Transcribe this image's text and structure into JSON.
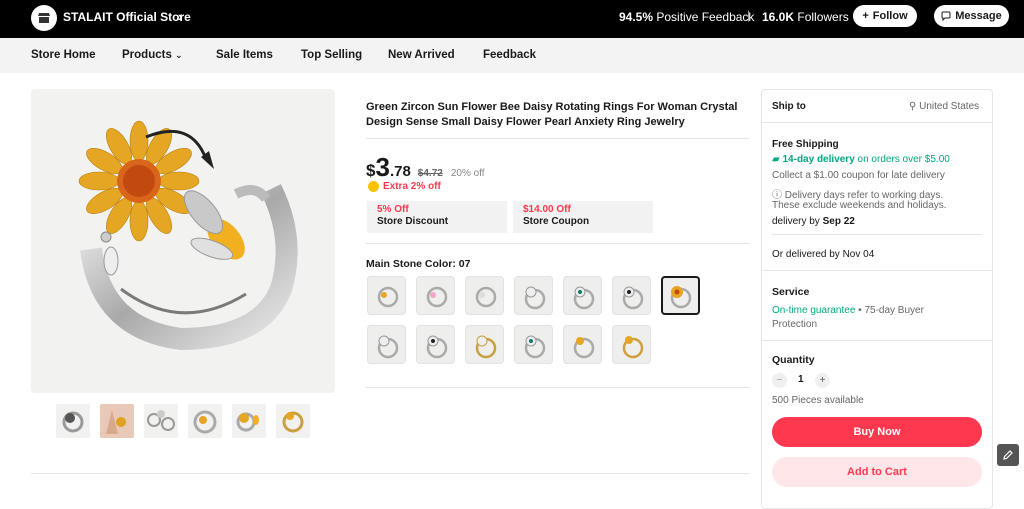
{
  "store": {
    "name": "STALAIT Official Store",
    "positive_feedback": "94.5%",
    "feedback_label": "Positive Feedback",
    "separator": "|",
    "followers_count": "16.0K",
    "followers_label": "Followers",
    "follow_label": "Follow",
    "message_label": "Message"
  },
  "nav": [
    "Store Home",
    "Products",
    "Sale Items",
    "Top Selling",
    "New Arrived",
    "Feedback"
  ],
  "product": {
    "title": "Green Zircon Sun Flower Bee Daisy Rotating Rings For Woman Crystal Design Sense Small Daisy Flower Pearl Anxiety Ring Jewelry",
    "currency": "$",
    "price_int": "3",
    "price_dec": ".78",
    "orig_price": "$4.72",
    "discount": "20% off",
    "extra_discount": "Extra 2% off",
    "coupons": [
      {
        "amount": "5% Off",
        "label": "Store Discount"
      },
      {
        "amount": "$14.00 Off",
        "label": "Store Coupon"
      }
    ],
    "stone_label": "Main Stone Color:",
    "stone_value": "07"
  },
  "ship": {
    "ship_to_label": "Ship to",
    "country": "United States",
    "free_shipping": "Free Shipping",
    "delivery_fast": "14-day delivery",
    "delivery_cond": "on orders over $5.00",
    "coupon_late": "Collect a $1.00 coupon for late delivery",
    "days_note_1": "Delivery days refer to working days.",
    "days_note_2": "These exclude weekends and holidays.",
    "delivery_by_label": "delivery by",
    "delivery_by_date": "Sep 22",
    "or_delivered": "Or delivered by Nov 04"
  },
  "service": {
    "title": "Service",
    "guarantee": "On-time guarantee",
    "buyer_1": " • 75-day Buyer",
    "buyer_2": "Protection"
  },
  "quantity": {
    "title": "Quantity",
    "minus": "−",
    "value": "1",
    "plus": "+",
    "available": "500 Pieces available"
  },
  "actions": {
    "buy_now": "Buy Now",
    "add_to_cart": "Add to Cart"
  },
  "colors": {
    "accent": "#fd384f",
    "green": "#00a87e",
    "gold": "#e8a317"
  }
}
